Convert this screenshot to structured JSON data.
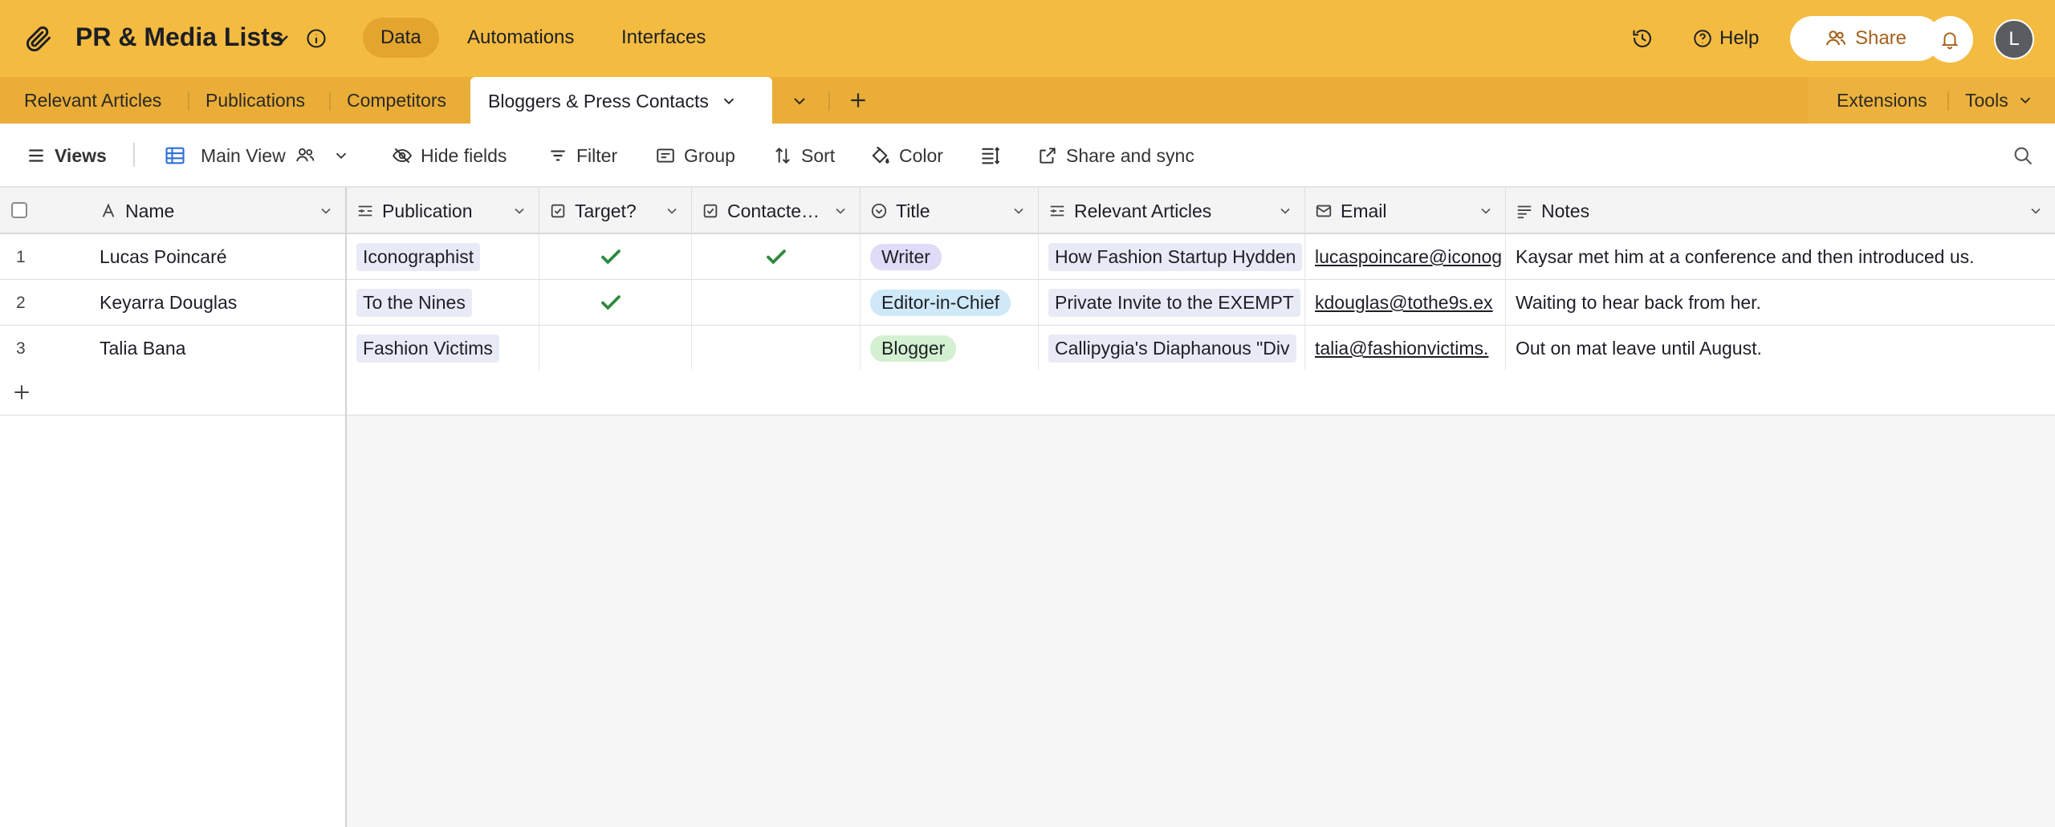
{
  "app": {
    "base_title": "PR & Media Lists",
    "nav": [
      "Data",
      "Automations",
      "Interfaces"
    ],
    "help_label": "Help",
    "share_label": "Share",
    "avatar_initial": "L",
    "colors": {
      "topbar": "#f4bb41",
      "tabbar": "#e9ad38",
      "check": "#2d8a3e"
    }
  },
  "tabs": {
    "items": [
      "Relevant Articles",
      "Publications",
      "Competitors",
      "Bloggers & Press Contacts"
    ],
    "active": "Bloggers & Press Contacts",
    "extensions_label": "Extensions",
    "tools_label": "Tools"
  },
  "toolbar": {
    "views_label": "Views",
    "view_name": "Main View",
    "hide_fields": "Hide fields",
    "filter": "Filter",
    "group": "Group",
    "sort": "Sort",
    "color": "Color",
    "share_sync": "Share and sync"
  },
  "table": {
    "columns": [
      "Name",
      "Publication",
      "Target?",
      "Contacte…",
      "Title",
      "Relevant Articles",
      "Email",
      "Notes"
    ],
    "rows": [
      {
        "num": "1",
        "name": "Lucas Poincaré",
        "publication": "Iconographist",
        "target": true,
        "contacted": true,
        "title": "Writer",
        "title_color": "#e0dbf6",
        "article": "How Fashion Startup Hydden",
        "email": "lucaspoincare@iconog",
        "notes": "Kaysar met him at a conference and then introduced us."
      },
      {
        "num": "2",
        "name": "Keyarra Douglas",
        "publication": "To the Nines",
        "target": true,
        "contacted": false,
        "title": "Editor-in-Chief",
        "title_color": "#cfe9f8",
        "article": "Private Invite to the EXEMPT",
        "email": "kdouglas@tothe9s.ex",
        "notes": "Waiting to hear back from her."
      },
      {
        "num": "3",
        "name": "Talia Bana",
        "publication": "Fashion Victims",
        "target": false,
        "contacted": false,
        "title": "Blogger",
        "title_color": "#d3f1d1",
        "article": "Callipygia's Diaphanous \"Div",
        "email": "talia@fashionvictims.",
        "notes": "Out on mat leave until August."
      }
    ]
  }
}
